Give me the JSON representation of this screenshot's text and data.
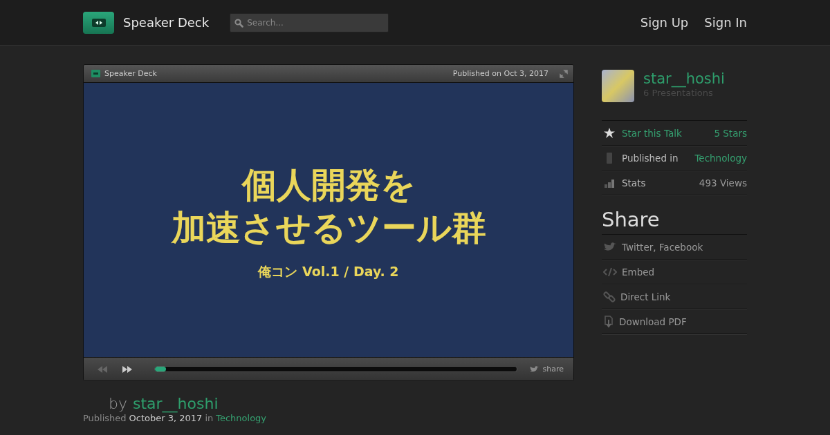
{
  "header": {
    "brand": "Speaker Deck",
    "search": {
      "placeholder": "Search..."
    },
    "nav": [
      "Sign Up",
      "Sign In"
    ]
  },
  "player": {
    "brand": "Speaker Deck",
    "published": "Published on Oct 3, 2017",
    "slide": {
      "title_lines": [
        "個人開発を",
        "加速させるツール群"
      ],
      "subtitle": "俺コン Vol.1 / Day. 2"
    },
    "progress": {
      "level": 0.03
    },
    "share": "share"
  },
  "byline": {
    "by": "by",
    "author": "star__hoshi",
    "published_label": "Published",
    "date": "October 3, 2017",
    "in": "in",
    "category": "Technology"
  },
  "sidebar": {
    "user": {
      "name": "star__hoshi",
      "presentations": "6 Presentations"
    },
    "stats": [
      {
        "kind": "star",
        "label": "Star this Talk",
        "value": "5 Stars"
      },
      {
        "kind": "published",
        "label": "Published in",
        "value": "Technology"
      },
      {
        "kind": "stats",
        "label": "Stats",
        "value": "493 Views"
      }
    ],
    "share_title": "Share",
    "share_items": [
      {
        "kind": "twitter",
        "label": "Twitter, Facebook"
      },
      {
        "kind": "embed",
        "label": "Embed"
      },
      {
        "kind": "link",
        "label": "Direct Link"
      },
      {
        "kind": "pdf",
        "label": "Download PDF"
      }
    ]
  }
}
